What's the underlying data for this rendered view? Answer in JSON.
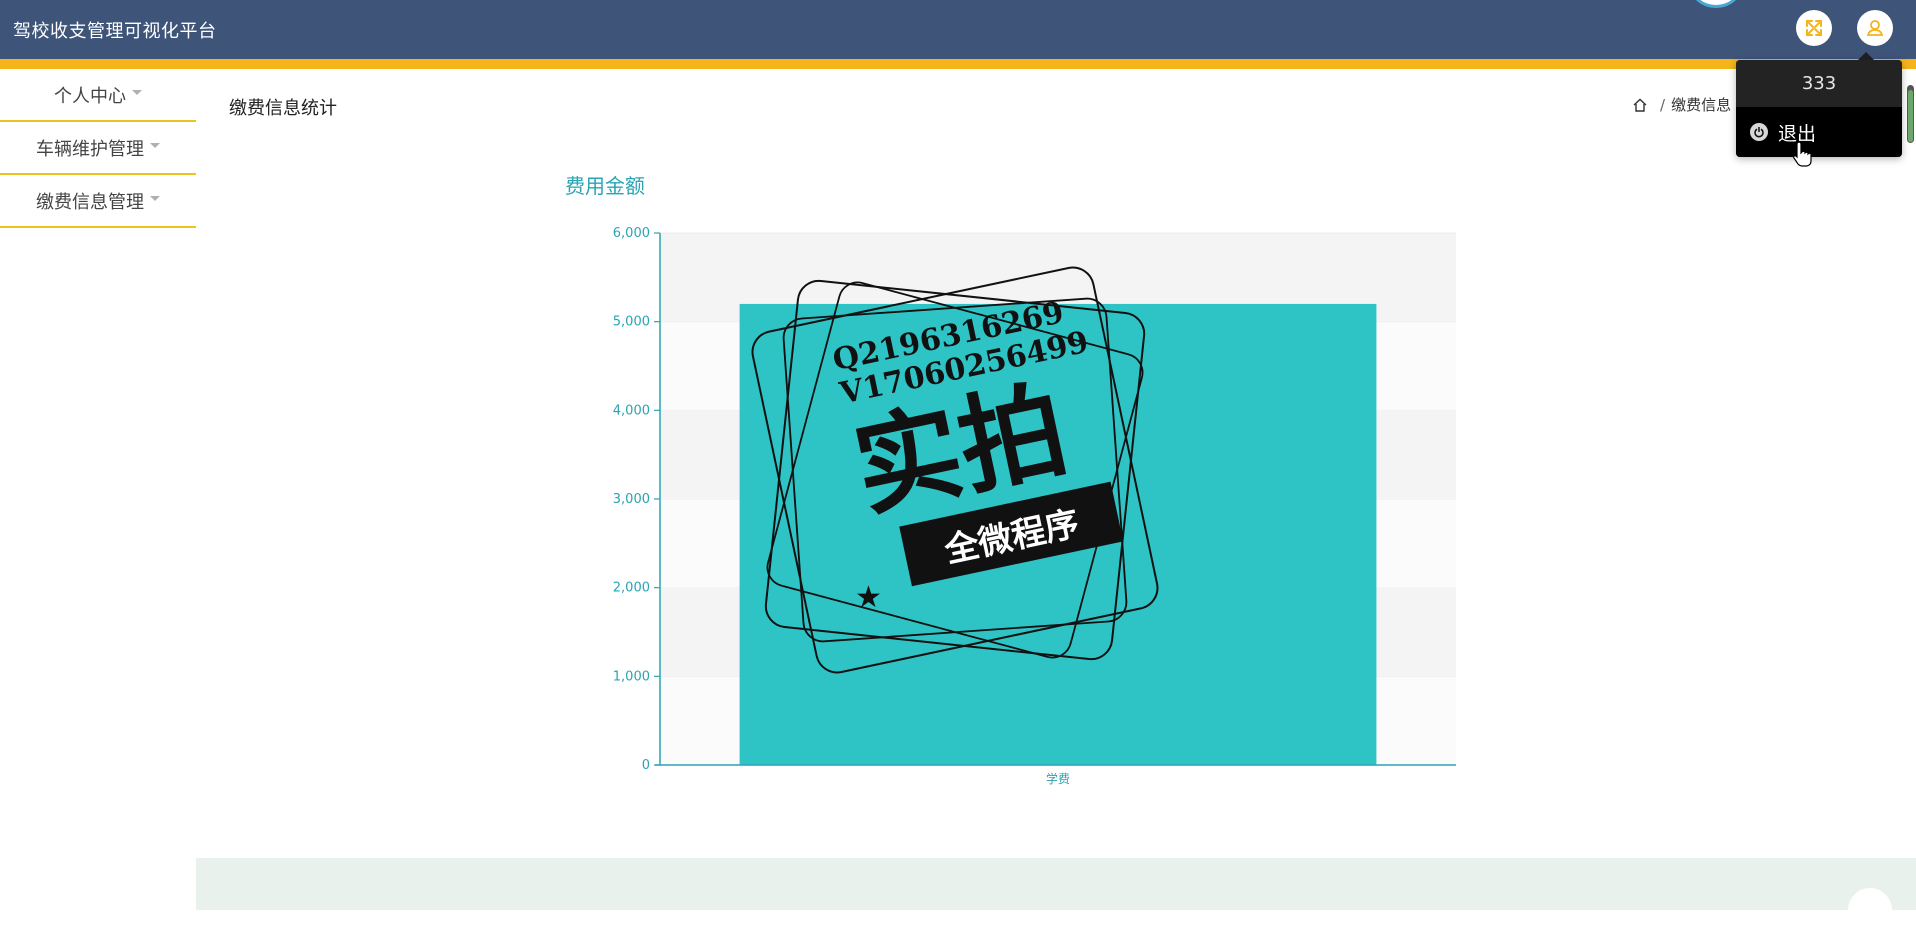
{
  "header": {
    "app_title": "驾校收支管理可视化平台"
  },
  "user_menu": {
    "username": "333",
    "logout_label": "退出"
  },
  "sidebar": {
    "items": [
      {
        "label": "个人中心"
      },
      {
        "label": "车辆维护管理"
      },
      {
        "label": "缴费信息管理"
      }
    ]
  },
  "page": {
    "title": "缴费信息统计",
    "breadcrumb_current": "缴费信息"
  },
  "watermark": {
    "line1": "Q2196316269",
    "line2": "V17060256499",
    "big": "实拍",
    "ribbon": "全微程序"
  },
  "colors": {
    "header_bg": "#3e5479",
    "accent": "#f4b41a",
    "bar": "#2ec4c6",
    "axis": "#2aa4b4"
  },
  "chart_data": {
    "type": "bar",
    "title": "费用金额",
    "categories": [
      "学费"
    ],
    "values": [
      5200
    ],
    "ylim": [
      0,
      6000
    ],
    "yticks": [
      "0",
      "1,000",
      "2,000",
      "3,000",
      "4,000",
      "5,000",
      "6,000"
    ],
    "ytick_values": [
      0,
      1000,
      2000,
      3000,
      4000,
      5000,
      6000
    ],
    "xlabel": "",
    "ylabel": "",
    "grid": true,
    "legend": "none"
  }
}
